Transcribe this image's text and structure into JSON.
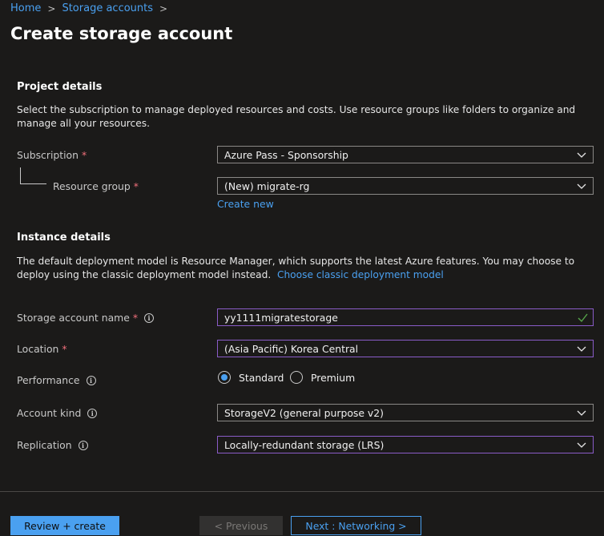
{
  "breadcrumb": {
    "items": [
      "Home",
      "Storage accounts"
    ],
    "separator": ">"
  },
  "page": {
    "title": "Create storage account"
  },
  "project_details": {
    "title": "Project details",
    "description": "Select the subscription to manage deployed resources and costs. Use resource groups like folders to organize and manage all your resources.",
    "subscription": {
      "label": "Subscription",
      "required": "*",
      "value": "Azure Pass - Sponsorship"
    },
    "resource_group": {
      "label": "Resource group",
      "required": "*",
      "value": "(New) migrate-rg",
      "create_new": "Create new"
    }
  },
  "instance_details": {
    "title": "Instance details",
    "description": "The default deployment model is Resource Manager, which supports the latest Azure features. You may choose to deploy using the classic deployment model instead.",
    "classic_link": "Choose classic deployment model",
    "storage_account_name": {
      "label": "Storage account name",
      "required": "*",
      "value": "yy1111migratestorage",
      "valid": true
    },
    "location": {
      "label": "Location",
      "required": "*",
      "value": "(Asia Pacific) Korea Central"
    },
    "performance": {
      "label": "Performance",
      "options": [
        "Standard",
        "Premium"
      ],
      "selected": "Standard"
    },
    "account_kind": {
      "label": "Account kind",
      "value": "StorageV2 (general purpose v2)"
    },
    "replication": {
      "label": "Replication",
      "value": "Locally-redundant storage (LRS)"
    }
  },
  "footer": {
    "review_create": "Review + create",
    "previous": "< Previous",
    "next": "Next : Networking >"
  },
  "colors": {
    "background": "#1b1a19",
    "accent": "#4aa0f0",
    "required": "#f1707b",
    "active_border": "#8a5cc8",
    "valid_check": "#57a64a"
  }
}
